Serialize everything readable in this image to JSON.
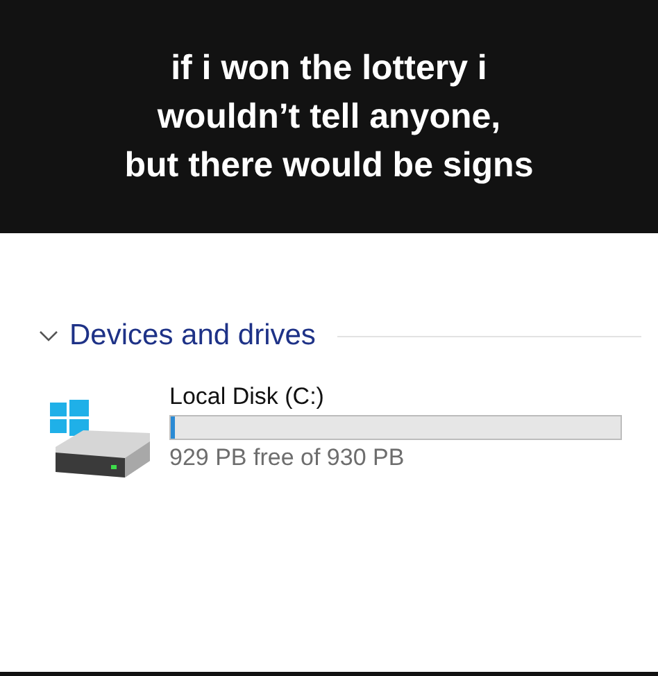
{
  "caption": {
    "lines": [
      "if i won the lottery i",
      "wouldn’t tell anyone,",
      "but there would be signs"
    ]
  },
  "section": {
    "title": "Devices and drives",
    "expanded": true
  },
  "drives": [
    {
      "name": "Local Disk (C:)",
      "level": 0.01,
      "reading": "929 PB free of 930 PB"
    }
  ]
}
